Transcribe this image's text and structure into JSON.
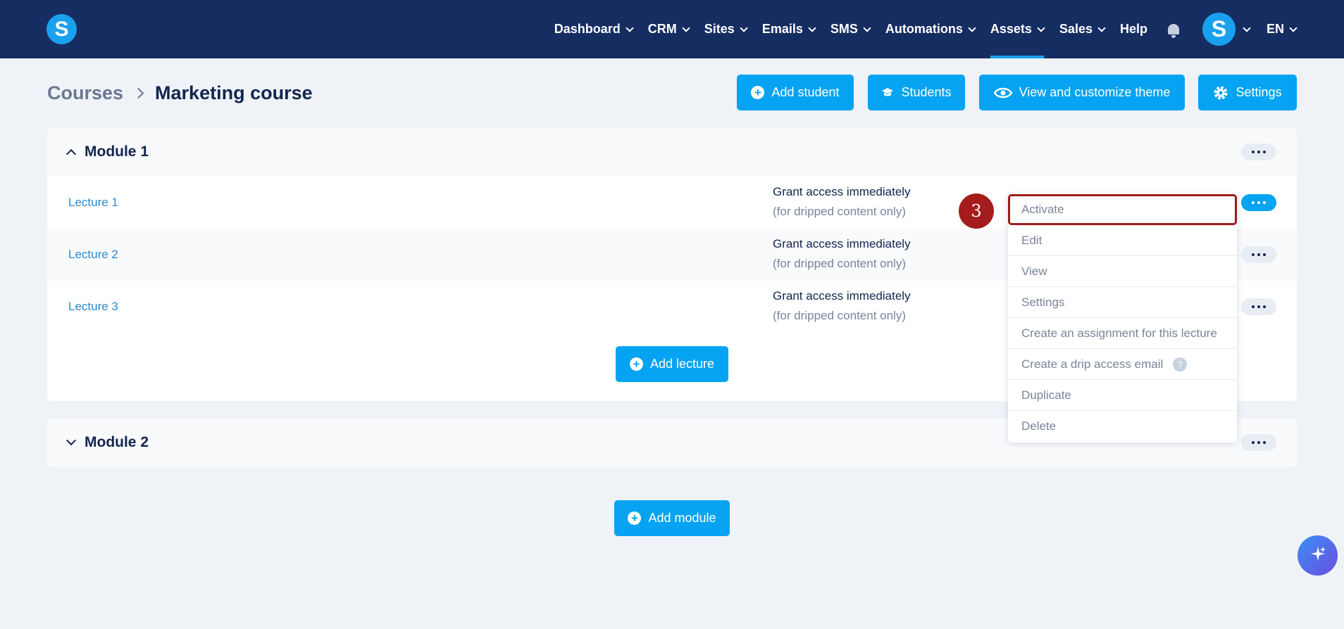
{
  "brand": {
    "logo_letter": "S"
  },
  "nav": {
    "items": [
      {
        "label": "Dashboard",
        "dropdown": true
      },
      {
        "label": "CRM",
        "dropdown": true
      },
      {
        "label": "Sites",
        "dropdown": true
      },
      {
        "label": "Emails",
        "dropdown": true
      },
      {
        "label": "SMS",
        "dropdown": true
      },
      {
        "label": "Automations",
        "dropdown": true
      },
      {
        "label": "Assets",
        "dropdown": true,
        "active": true
      },
      {
        "label": "Sales",
        "dropdown": true
      },
      {
        "label": "Help",
        "dropdown": false
      }
    ],
    "avatar_letter": "S",
    "language": "EN"
  },
  "breadcrumb": {
    "root": "Courses",
    "current": "Marketing course"
  },
  "header_buttons": {
    "add_student": "Add student",
    "students": "Students",
    "view_theme": "View and customize theme",
    "settings": "Settings"
  },
  "modules": [
    {
      "title": "Module 1",
      "expanded": true,
      "lectures": [
        {
          "title": "Lecture 1",
          "access": "Grant access immediately",
          "access_note": "(for dripped content only)"
        },
        {
          "title": "Lecture 2",
          "access": "Grant access immediately",
          "access_note": "(for dripped content only)"
        },
        {
          "title": "Lecture 3",
          "access": "Grant access immediately",
          "access_note": "(for dripped content only)"
        }
      ],
      "add_lecture_label": "Add lecture"
    },
    {
      "title": "Module 2",
      "expanded": false
    }
  ],
  "lecture_menu": {
    "items": [
      "Activate",
      "Edit",
      "View",
      "Settings",
      "Create an assignment for this lecture",
      "Create a drip access email",
      "Duplicate",
      "Delete"
    ],
    "help_glyph": "?"
  },
  "annotation": {
    "step": "3"
  },
  "add_module_label": "Add module",
  "colors": {
    "nav_bg": "#162d62",
    "accent": "#05a3f1",
    "highlight": "#a01b1b"
  }
}
